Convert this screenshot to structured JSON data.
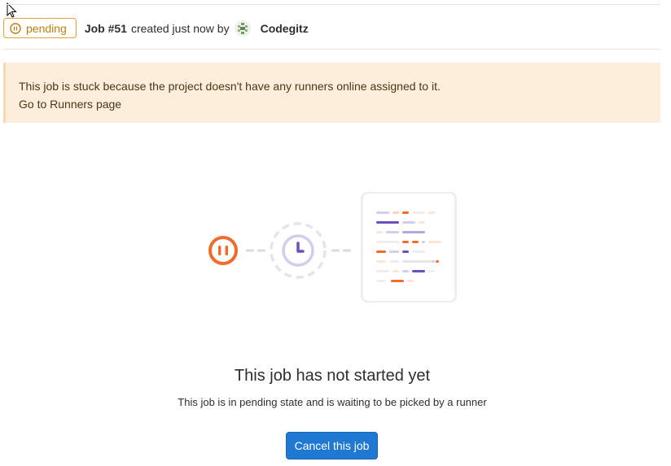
{
  "header": {
    "status_label": "pending",
    "job_title": "Job #51",
    "job_meta": "created just now by",
    "user_name": "Codegitz"
  },
  "alert": {
    "message": "This job is stuck because the project doesn't have any runners online assigned to it.",
    "link_label": "Go to Runners page"
  },
  "empty_state": {
    "title": "This job has not started yet",
    "description": "This job is in pending state and is waiting to be picked by a runner",
    "cancel_label": "Cancel this job"
  },
  "colors": {
    "pending": "#e9a23a",
    "alert_bg": "#fdeedc",
    "primary": "#1f78d1",
    "illustration_orange": "#f16c2a",
    "illustration_purple": "#6b4fbb"
  },
  "icons": {
    "status": "pause-icon",
    "avatar": "identicon",
    "illustration_left": "pause-icon",
    "illustration_mid": "clock-icon",
    "illustration_right": "log-document-icon"
  }
}
